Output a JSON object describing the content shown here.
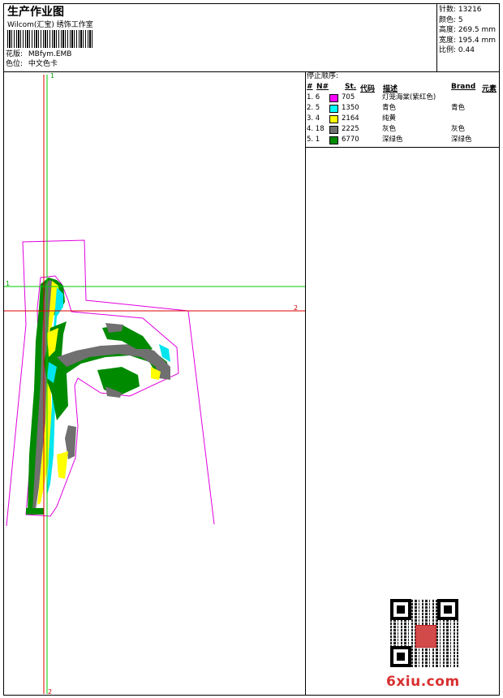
{
  "header": {
    "title": "生产作业图",
    "studio": "Wilcom(汇宝) 绣饰工作室",
    "design_label": "花版:",
    "design_value": "MBfym.EMB",
    "color_label": "色位:",
    "color_value": "中文色卡"
  },
  "stats": {
    "stitches": "针数: 13216",
    "colors": "颜色: 5",
    "height": "高度: 269.5 mm",
    "width": "宽度: 195.4 mm",
    "scale": "比例: 0.44"
  },
  "stop_sequence": {
    "heading": "停止顺序:",
    "columns": {
      "hash": "#",
      "n": "N#",
      "st": "St.",
      "code": "代码",
      "desc": "描述",
      "brand": "Brand",
      "elem": "元素"
    },
    "rows": [
      {
        "idx": "1. 6",
        "color": "#ff00ff",
        "code": "705",
        "desc": "灯笼海棠(紫红色)",
        "brand": ""
      },
      {
        "idx": "2. 5",
        "color": "#00ffff",
        "code": "1350",
        "desc": "青色",
        "brand": "青色"
      },
      {
        "idx": "3. 4",
        "color": "#ffff00",
        "code": "2164",
        "desc": "纯黄",
        "brand": ""
      },
      {
        "idx": "4. 18",
        "color": "#707070",
        "code": "2225",
        "desc": "灰色",
        "brand": "灰色"
      },
      {
        "idx": "5. 1",
        "color": "#008a00",
        "code": "6770",
        "desc": "深绿色",
        "brand": "深绿色"
      }
    ]
  },
  "guides": {
    "v1_top": "1",
    "h1_left": "1",
    "h2_right": "2",
    "v2_bottom": "2"
  },
  "watermark": "6xiu.com"
}
